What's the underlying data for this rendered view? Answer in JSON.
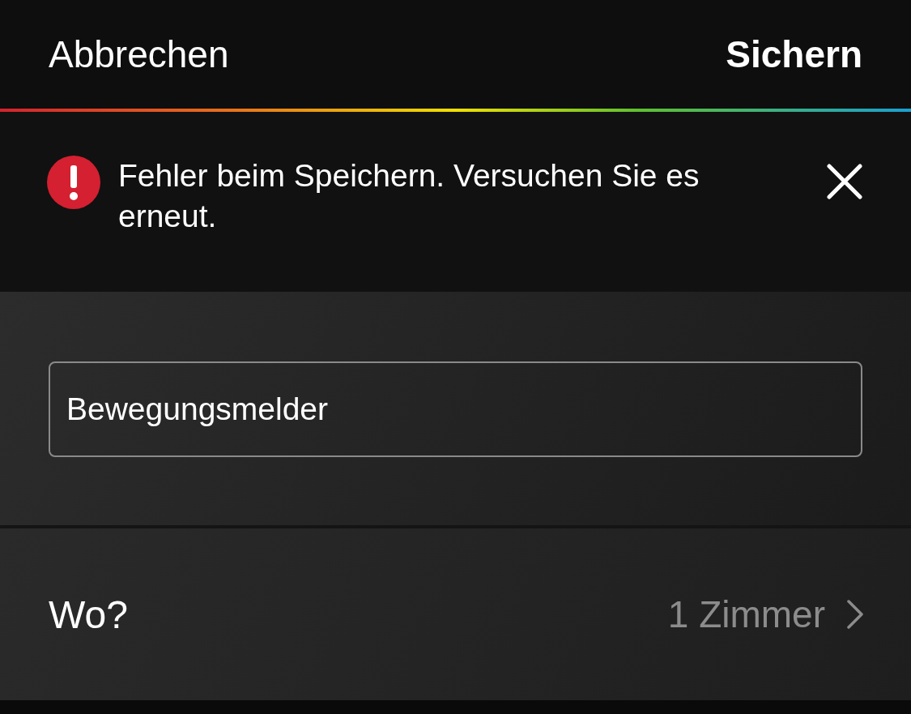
{
  "header": {
    "cancel": "Abbrechen",
    "save": "Sichern"
  },
  "error": {
    "message": "Fehler beim Speichern. Versuchen Sie es erneut."
  },
  "name_field": {
    "value": "Bewegungsmelder"
  },
  "location": {
    "label": "Wo?",
    "value": "1 Zimmer"
  }
}
